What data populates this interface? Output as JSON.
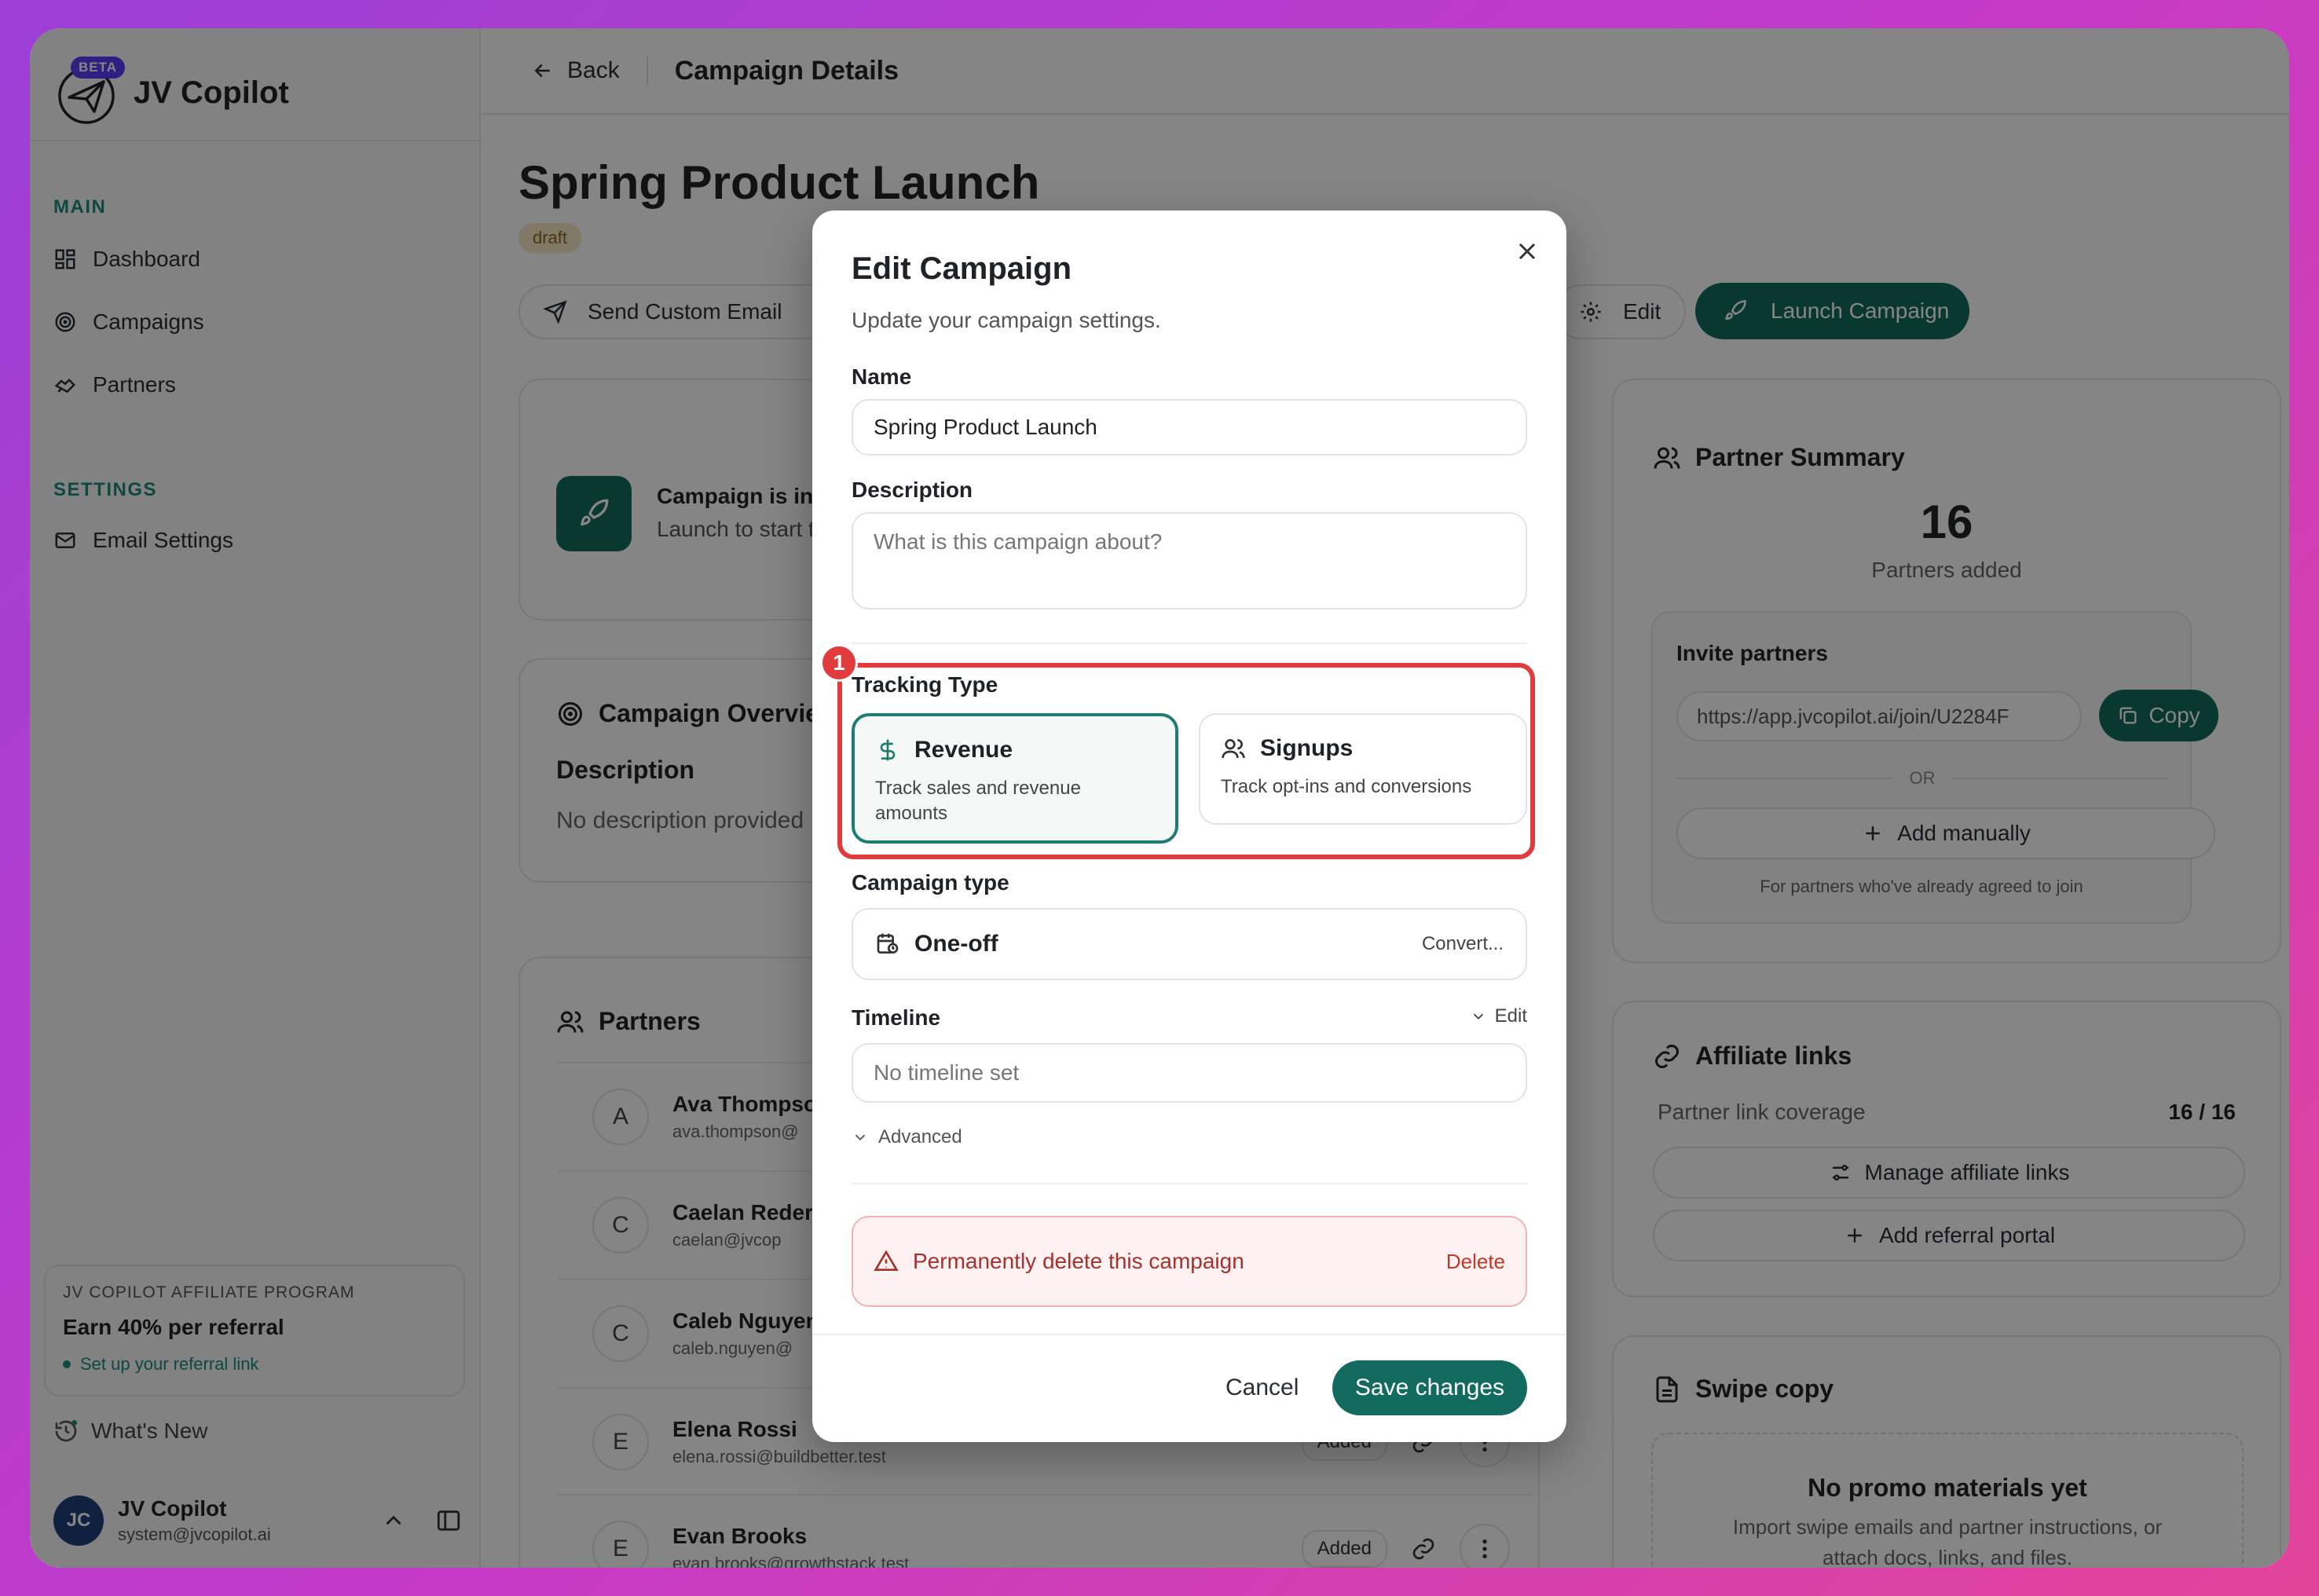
{
  "app": {
    "name": "JV Copilot",
    "beta": "BETA"
  },
  "sidebar": {
    "main_label": "MAIN",
    "settings_label": "SETTINGS",
    "items": [
      {
        "label": "Dashboard",
        "icon": "grid-icon"
      },
      {
        "label": "Campaigns",
        "icon": "target-icon"
      },
      {
        "label": "Partners",
        "icon": "handshake-icon"
      }
    ],
    "settings_items": [
      {
        "label": "Email Settings",
        "icon": "mail-icon"
      }
    ],
    "affiliate": {
      "label": "JV COPILOT AFFILIATE PROGRAM",
      "title": "Earn 40% per referral",
      "link": "Set up your referral link"
    },
    "whats_new": "What's New",
    "user": {
      "initials": "JC",
      "name": "JV Copilot",
      "email": "system@jvcopilot.ai"
    }
  },
  "header": {
    "back": "Back",
    "title": "Campaign Details"
  },
  "campaign": {
    "title": "Spring Product Launch",
    "status": "draft",
    "send_email": "Send Custom Email",
    "edit": "Edit",
    "launch": "Launch Campaign",
    "info_title": "Campaign is in draft",
    "info_sub": "Launch to start tracking",
    "overview_title": "Campaign Overview",
    "description_label": "Description",
    "description_value": "No description provided"
  },
  "partners": {
    "title": "Partners",
    "rows": [
      {
        "initial": "A",
        "name": "Ava Thompson",
        "email": "ava.thompson@"
      },
      {
        "initial": "C",
        "name": "Caelan Reder",
        "email": "caelan@jvcop"
      },
      {
        "initial": "C",
        "name": "Caleb Nguyen",
        "email": "caleb.nguyen@"
      },
      {
        "initial": "E",
        "name": "Elena Rossi",
        "email": "elena.rossi@buildbetter.test",
        "status": "Added"
      },
      {
        "initial": "E",
        "name": "Evan Brooks",
        "email": "evan.brooks@growthstack.test",
        "status": "Added"
      }
    ]
  },
  "summary": {
    "title": "Partner Summary",
    "count": "16",
    "count_label": "Partners added",
    "invite_label": "Invite partners",
    "invite_url": "https://app.jvcopilot.ai/join/U2284F",
    "copy": "Copy",
    "or": "OR",
    "add_manually": "Add manually",
    "note": "For partners who've already agreed to join"
  },
  "affiliate_links": {
    "title": "Affiliate links",
    "coverage_label": "Partner link coverage",
    "coverage_value": "16 / 16",
    "manage": "Manage affiliate links",
    "add_portal": "Add referral portal"
  },
  "swipe": {
    "title": "Swipe copy",
    "empty_title": "No promo materials yet",
    "empty_desc_1": "Import swipe emails and partner instructions, or",
    "empty_desc_2": "attach docs, links, and files."
  },
  "modal": {
    "title": "Edit Campaign",
    "subtitle": "Update your campaign settings.",
    "name_label": "Name",
    "name_value": "Spring Product Launch",
    "description_label": "Description",
    "description_placeholder": "What is this campaign about?",
    "tracking_label": "Tracking Type",
    "annotation_number": "1",
    "revenue_title": "Revenue",
    "revenue_desc": "Track sales and revenue amounts",
    "signups_title": "Signups",
    "signups_desc": "Track opt-ins and conversions",
    "campaign_type_label": "Campaign type",
    "campaign_type_value": "One-off",
    "convert": "Convert...",
    "timeline_label": "Timeline",
    "timeline_edit": "Edit",
    "timeline_value": "No timeline set",
    "advanced": "Advanced",
    "danger_text": "Permanently delete this campaign",
    "delete": "Delete",
    "cancel": "Cancel",
    "save": "Save changes"
  },
  "colors": {
    "accent": "#136b5f",
    "danger": "#e23b3b",
    "bg_gradient_start": "#9b3fd6",
    "bg_gradient_end": "#e2449a"
  }
}
